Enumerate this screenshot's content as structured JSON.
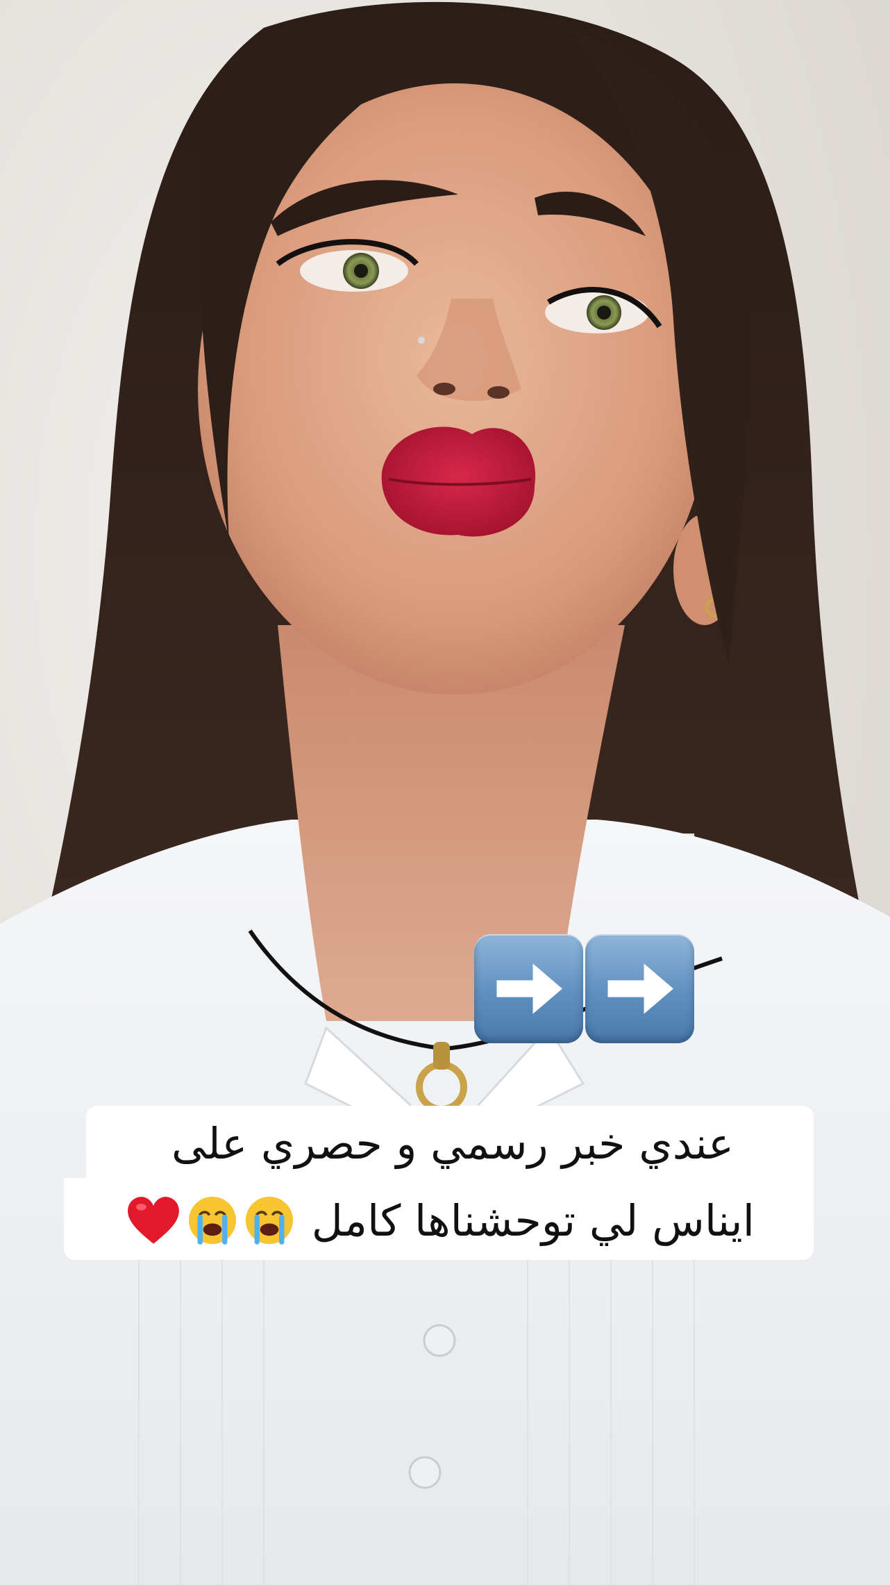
{
  "caption": {
    "line1": "عندي خبر رسمي و حصري على",
    "line2_text": "ايناس لي توحشناها كامل",
    "line2_emojis": [
      "crying-face-emoji",
      "crying-face-emoji",
      "red-heart-emoji"
    ]
  },
  "stickers": {
    "arrows": [
      "right-arrow-button-emoji",
      "right-arrow-button-emoji"
    ]
  },
  "colors": {
    "caption_bg": "#ffffff",
    "caption_text": "#111111",
    "arrow_tile": "#5e8fbf",
    "lips": "#c0183a",
    "hair": "#2a1c16",
    "shirt": "#f3f4f6",
    "background": "#ebe8e5"
  }
}
